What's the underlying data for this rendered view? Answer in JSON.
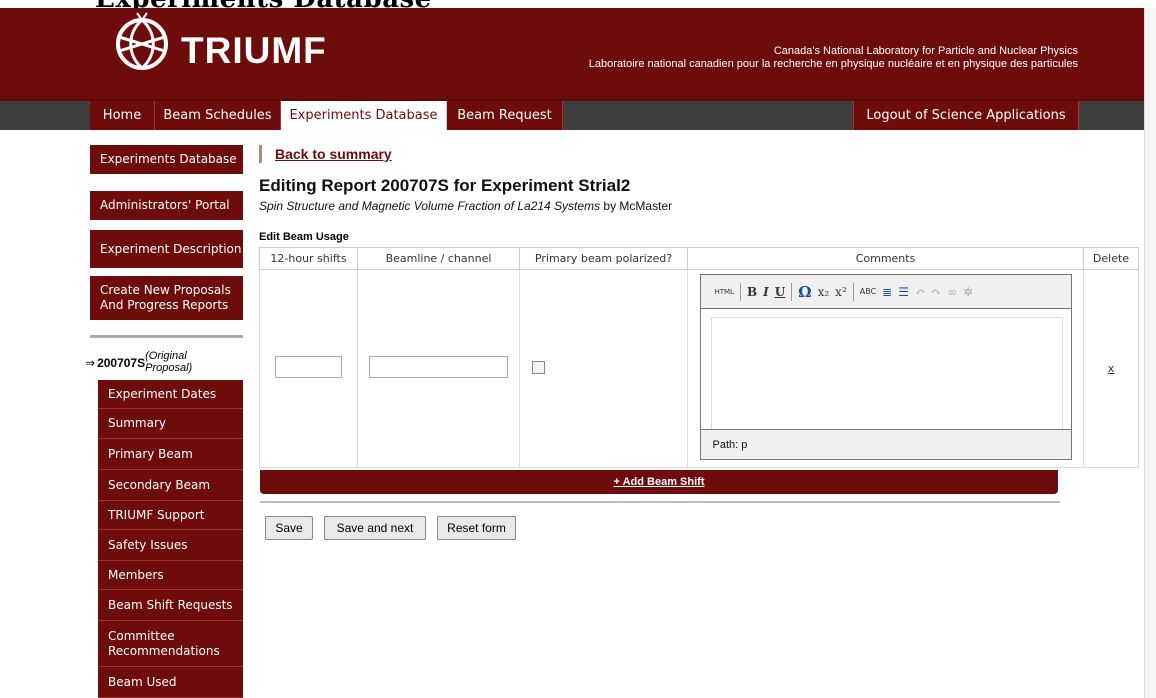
{
  "top_cut_text": "Experiments Database",
  "header": {
    "logo_text": "TRIUMF",
    "tagline_line1": "Canada's National Laboratory for Particle and Nuclear Physics",
    "tagline_line2": "Laboratoire national canadien pour la recherche en physique nucléaire et en physique des particules"
  },
  "nav": {
    "home": "Home",
    "beam_schedules": "Beam Schedules",
    "experiments_database": "Experiments Database",
    "beam_request": "Beam Request",
    "logout": "Logout of Science Applications"
  },
  "sidebar": {
    "experiments_database": "Experiments Database",
    "administrators_portal": "Administrators' Portal",
    "experiment_description": "Experiment Description",
    "create_new": "Create New Proposals And Progress Reports",
    "report_id": "200707S",
    "report_note": "(Original Proposal)",
    "sub_items": [
      "Experiment Dates",
      "Summary",
      "Primary Beam",
      "Secondary Beam",
      "TRIUMF Support",
      "Safety Issues",
      "Members",
      "Beam Shift Requests",
      "Committee Recommendations",
      "Beam Used"
    ]
  },
  "main": {
    "back_link": "Back to summary",
    "title": "Editing Report 200707S for Experiment Strial2",
    "subtitle_italic": "Spin Structure and Magnetic Volume Fraction of La214 Systems",
    "subtitle_rest": " by McMaster",
    "section_label": "Edit Beam Usage",
    "table_headers": [
      "12-hour shifts",
      "Beamline / channel",
      "Primary beam polarized?",
      "Comments",
      "Delete"
    ],
    "editor_path": "Path: p",
    "delete_label": "x",
    "add_beam_shift": "+ Add Beam Shift",
    "buttons": {
      "save": "Save",
      "save_next": "Save and next",
      "reset": "Reset form"
    }
  },
  "colors": {
    "brand": "#6e0c0c",
    "nav_bg": "#3e3e3e"
  }
}
